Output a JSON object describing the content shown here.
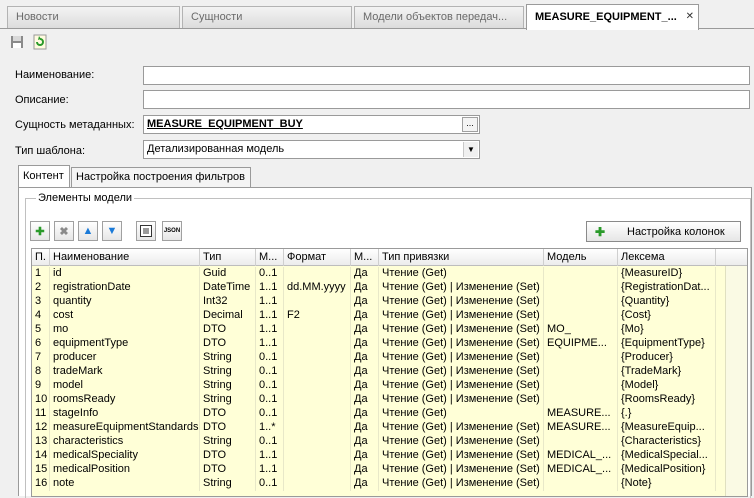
{
  "tabs": [
    {
      "label": "Новости",
      "active": false
    },
    {
      "label": "Сущности",
      "active": false
    },
    {
      "label": "Модели  объектов  передач...",
      "active": false
    },
    {
      "label": "MEASURE_EQUIPMENT_...",
      "active": true
    }
  ],
  "toolbar": {
    "save_icon": "save-icon",
    "refresh_icon": "refresh-icon"
  },
  "form": {
    "name_label": "Наименование:",
    "name_value": "",
    "desc_label": "Описание:",
    "desc_value": "",
    "entity_label": "Сущность метаданных:",
    "entity_value": "MEASURE_EQUIPMENT_BUY",
    "entity_button": "...",
    "template_label": "Тип шаблона:",
    "template_value": "Детализированная модель"
  },
  "subtabs": [
    {
      "label": "Контент",
      "active": true
    },
    {
      "label": "Настройка построения фильтров",
      "active": false
    }
  ],
  "group": {
    "title": "Элементы модели",
    "columns_button": "Настройка колонок",
    "json_label": "JSON"
  },
  "grid": {
    "headers": [
      "П.",
      "Наименование",
      "Тип",
      "М...",
      "Формат",
      "М...",
      "Тип привязки",
      "Модель",
      "Лексема"
    ],
    "rows": [
      [
        "1",
        "id",
        "Guid",
        "0..1",
        "",
        "Да",
        "Чтение (Get)",
        "",
        "{MeasureID}"
      ],
      [
        "2",
        "registrationDate",
        "DateTime",
        "1..1",
        "dd.MM.yyyy",
        "Да",
        "Чтение (Get) | Изменение (Set)",
        "",
        "{RegistrationDat..."
      ],
      [
        "3",
        "quantity",
        "Int32",
        "1..1",
        "",
        "Да",
        "Чтение (Get) | Изменение (Set)",
        "",
        "{Quantity}"
      ],
      [
        "4",
        "cost",
        "Decimal",
        "1..1",
        "F2",
        "Да",
        "Чтение (Get) | Изменение (Set)",
        "",
        "{Cost}"
      ],
      [
        "5",
        "mo",
        "DTO",
        "1..1",
        "",
        "Да",
        "Чтение (Get) | Изменение (Set)",
        "MO_",
        "{Mo}"
      ],
      [
        "6",
        "equipmentType",
        "DTO",
        "1..1",
        "",
        "Да",
        "Чтение (Get) | Изменение (Set)",
        "EQUIPME...",
        "{EquipmentType}"
      ],
      [
        "7",
        "producer",
        "String",
        "0..1",
        "",
        "Да",
        "Чтение (Get) | Изменение (Set)",
        "",
        "{Producer}"
      ],
      [
        "8",
        "tradeMark",
        "String",
        "0..1",
        "",
        "Да",
        "Чтение (Get) | Изменение (Set)",
        "",
        "{TradeMark}"
      ],
      [
        "9",
        "model",
        "String",
        "0..1",
        "",
        "Да",
        "Чтение (Get) | Изменение (Set)",
        "",
        "{Model}"
      ],
      [
        "10",
        "roomsReady",
        "String",
        "0..1",
        "",
        "Да",
        "Чтение (Get) | Изменение (Set)",
        "",
        "{RoomsReady}"
      ],
      [
        "11",
        "stageInfo",
        "DTO",
        "0..1",
        "",
        "Да",
        "Чтение (Get)",
        "MEASURE...",
        "{.}"
      ],
      [
        "12",
        "measureEquipmentStandards",
        "DTO",
        "1..*",
        "",
        "Да",
        "Чтение (Get) | Изменение (Set)",
        "MEASURE...",
        "{MeasureEquip..."
      ],
      [
        "13",
        "characteristics",
        "String",
        "0..1",
        "",
        "Да",
        "Чтение (Get) | Изменение (Set)",
        "",
        "{Characteristics}"
      ],
      [
        "14",
        "medicalSpeciality",
        "DTO",
        "1..1",
        "",
        "Да",
        "Чтение (Get) | Изменение (Set)",
        "MEDICAL_...",
        "{MedicalSpecial..."
      ],
      [
        "15",
        "medicalPosition",
        "DTO",
        "1..1",
        "",
        "Да",
        "Чтение (Get) | Изменение (Set)",
        "MEDICAL_...",
        "{MedicalPosition}"
      ],
      [
        "16",
        "note",
        "String",
        "0..1",
        "",
        "Да",
        "Чтение (Get) | Изменение (Set)",
        "",
        "{Note}"
      ]
    ]
  }
}
